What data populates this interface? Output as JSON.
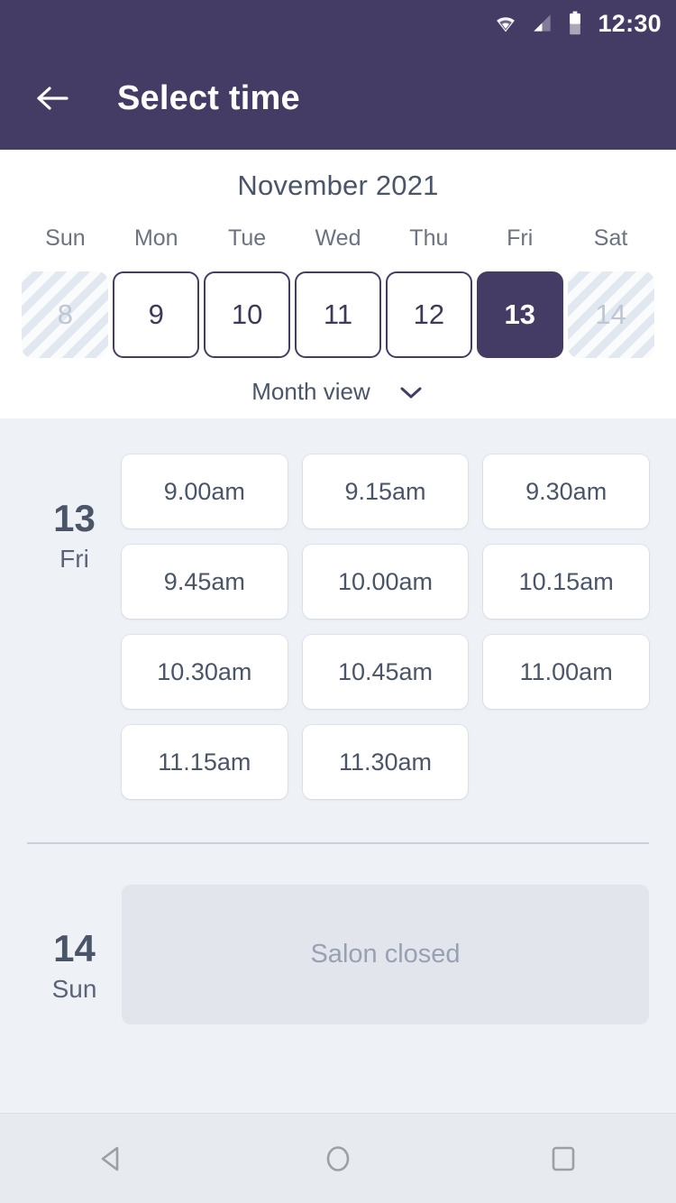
{
  "status_bar": {
    "time": "12:30",
    "icons": [
      "wifi-icon",
      "cellular-signal-icon",
      "battery-icon"
    ]
  },
  "app_bar": {
    "back_icon": "arrow-left-icon",
    "title": "Select time"
  },
  "calendar": {
    "month_title": "November 2021",
    "weekdays": [
      "Sun",
      "Mon",
      "Tue",
      "Wed",
      "Thu",
      "Fri",
      "Sat"
    ],
    "days": [
      {
        "num": "8",
        "state": "disabled"
      },
      {
        "num": "9",
        "state": "enabled"
      },
      {
        "num": "10",
        "state": "enabled"
      },
      {
        "num": "11",
        "state": "enabled"
      },
      {
        "num": "12",
        "state": "enabled"
      },
      {
        "num": "13",
        "state": "selected"
      },
      {
        "num": "14",
        "state": "disabled"
      }
    ],
    "view_toggle": {
      "label": "Month view",
      "icon": "chevron-down-icon"
    }
  },
  "schedule": {
    "days": [
      {
        "day_number": "13",
        "day_name": "Fri",
        "slots": [
          "9.00am",
          "9.15am",
          "9.30am",
          "9.45am",
          "10.00am",
          "10.15am",
          "10.30am",
          "10.45am",
          "11.00am",
          "11.15am",
          "11.30am"
        ]
      }
    ],
    "closed_day": {
      "day_number": "14",
      "day_name": "Sun",
      "message": "Salon closed"
    }
  },
  "nav_bar": {
    "back": "triangle-back-icon",
    "home": "circle-home-icon",
    "recents": "square-recents-icon"
  },
  "colors": {
    "primary": "#453C65",
    "background": "#EEF2F7",
    "panel": "#FFFFFF",
    "text_dark": "#4A5568",
    "text_muted": "#6B7280",
    "closed_bg": "#E2E6EC",
    "closed_text": "#98A1B3"
  }
}
